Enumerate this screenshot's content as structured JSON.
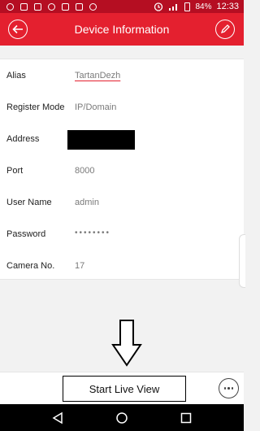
{
  "status_bar": {
    "battery": "84%",
    "time": "12:33",
    "icons": [
      "clock-alarm-icon",
      "signal-icon",
      "battery-icon"
    ]
  },
  "app_bar": {
    "title": "Device Information",
    "back_icon": "back-arrow-icon",
    "edit_icon": "pencil-icon"
  },
  "form": {
    "rows": [
      {
        "label": "Alias",
        "value": "TartanDezh"
      },
      {
        "label": "Register Mode",
        "value": "IP/Domain"
      },
      {
        "label": "Address",
        "value": ""
      },
      {
        "label": "Port",
        "value": "8000"
      },
      {
        "label": "User Name",
        "value": "admin"
      },
      {
        "label": "Password",
        "value": "••••••••"
      },
      {
        "label": "Camera No.",
        "value": "17"
      }
    ]
  },
  "bottom_bar": {
    "primary_label": "Start Live View",
    "more_icon": "more-horizontal-icon"
  },
  "colors": {
    "accent": "#e4202f",
    "status_bar": "#b50e22"
  }
}
